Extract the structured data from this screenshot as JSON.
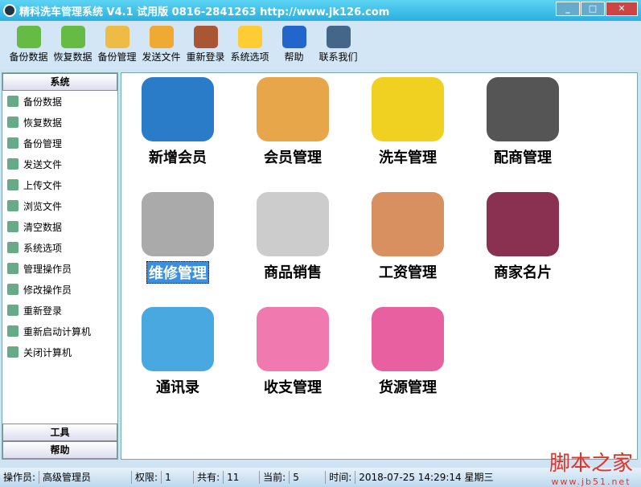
{
  "title": "精科洗车管理系统 V4.1 试用版 0816-2841263 http://www.jk126.com",
  "toolbar": [
    "备份数据",
    "恢复数据",
    "备份管理",
    "发送文件",
    "重新登录",
    "系统选项",
    "帮助",
    "联系我们"
  ],
  "sidebar": {
    "section": "系统",
    "items": [
      "备份数据",
      "恢复数据",
      "备份管理",
      "发送文件",
      "上传文件",
      "浏览文件",
      "清空数据",
      "系统选项",
      "管理操作员",
      "修改操作员",
      "重新登录",
      "重新启动计算机",
      "关闭计算机"
    ],
    "bottom": [
      "工具",
      "帮助"
    ]
  },
  "tiles": [
    "新增会员",
    "会员管理",
    "洗车管理",
    "配商管理",
    "维修管理",
    "商品销售",
    "工资管理",
    "商家名片",
    "通讯录",
    "收支管理",
    "货源管理"
  ],
  "status": {
    "operator_label": "操作员:",
    "operator": "高级管理员",
    "perm_label": "权限:",
    "perm": "1",
    "total_label": "共有:",
    "total": "11",
    "current_label": "当前:",
    "current": "5",
    "time_label": "时间:",
    "time": "2018-07-25 14:29:14 星期三"
  },
  "watermark": {
    "text": "脚本之家",
    "url": "www.jb51.net"
  }
}
